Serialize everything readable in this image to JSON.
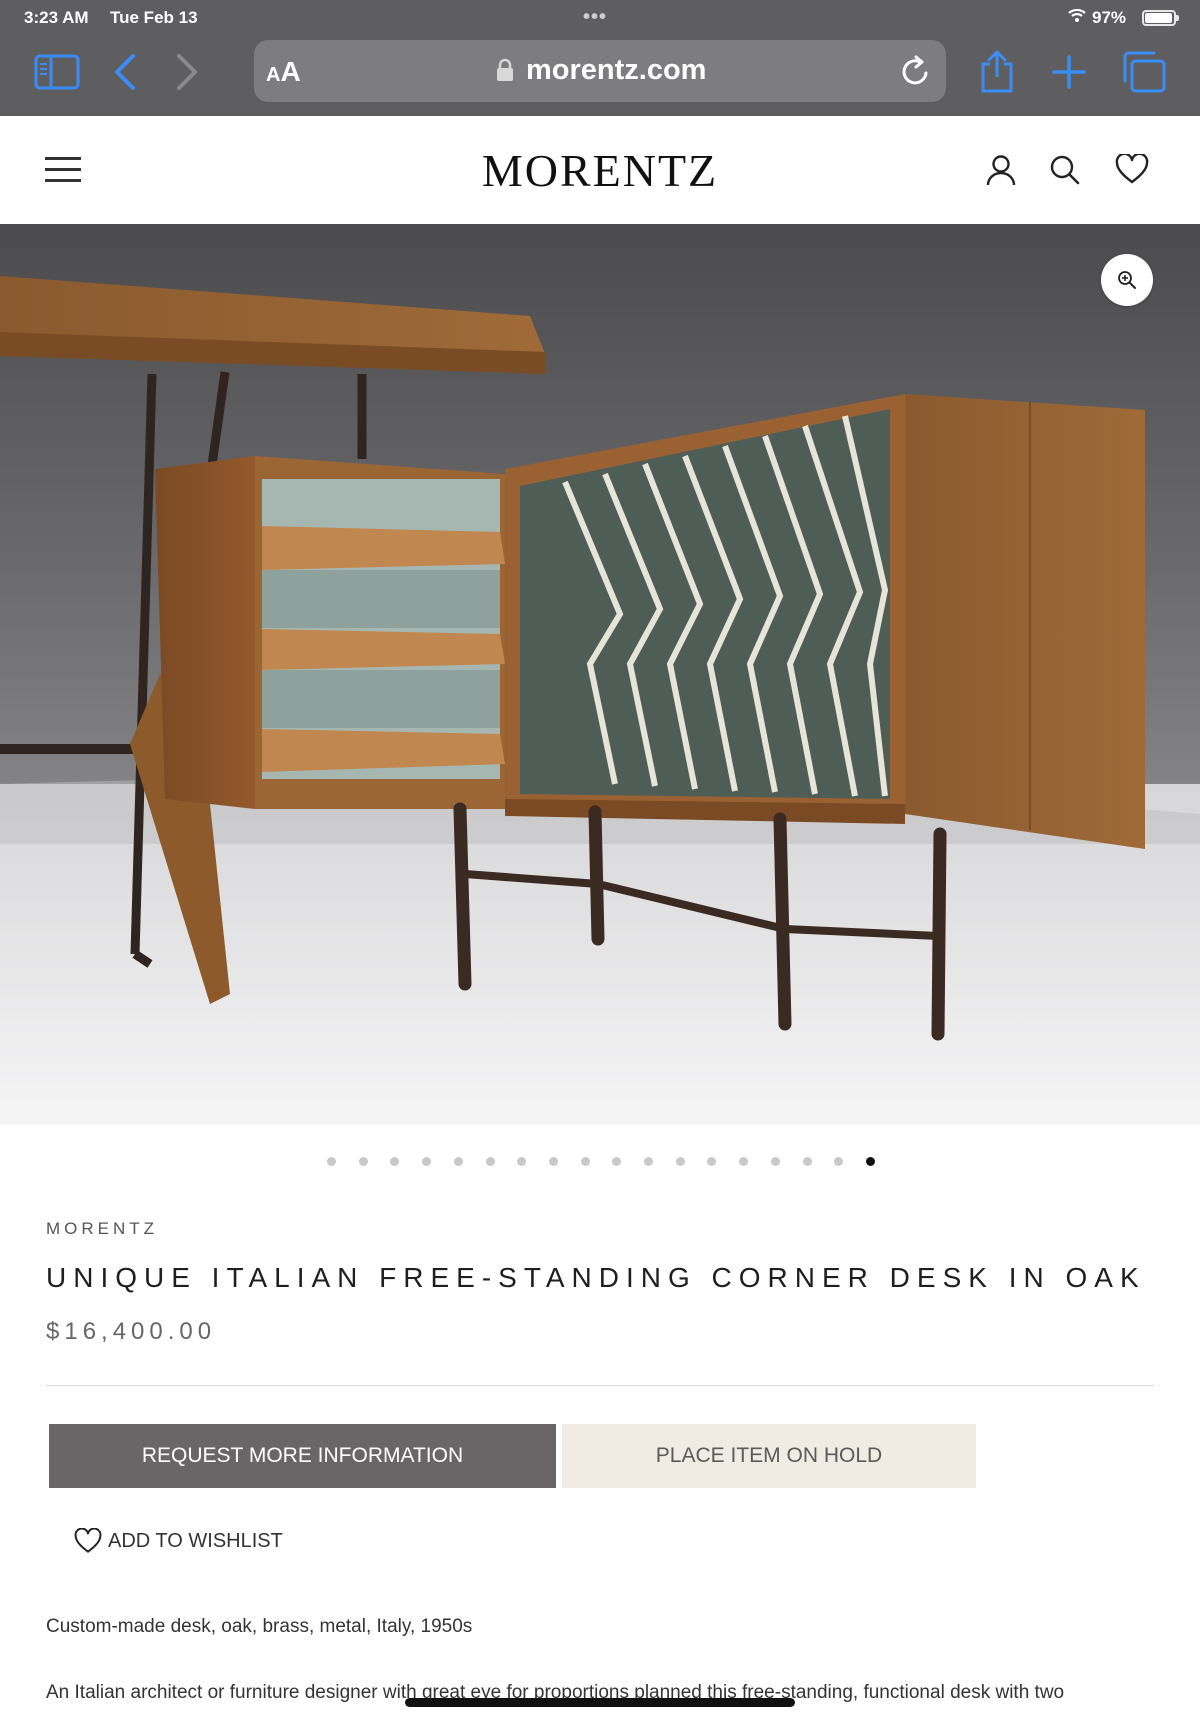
{
  "status_bar": {
    "time": "3:23 AM",
    "date": "Tue Feb 13",
    "battery": "97%",
    "dots": "•••"
  },
  "browser": {
    "text_size_small": "A",
    "text_size_big": "A",
    "url_host": "morentz.com",
    "accent_color": "#3b8cf5"
  },
  "site": {
    "logo": "MORENTZ"
  },
  "gallery": {
    "image_count": 18,
    "active_index": 17
  },
  "product": {
    "vendor": "MORENTZ",
    "title": "UNIQUE ITALIAN FREE-STANDING CORNER DESK IN OAK",
    "price": "$16,400.00",
    "request_label": "REQUEST MORE INFORMATION",
    "hold_label": "PLACE ITEM ON HOLD",
    "wishlist_label": "ADD TO WISHLIST",
    "description_1": "Custom-made desk, oak, brass, metal, Italy, 1950s",
    "description_2": "An Italian architect or furniture designer with great eye for proportions planned this free-standing, functional desk with two"
  },
  "icons": {
    "sidebar": "sidebar-icon",
    "back": "chevron-left-icon",
    "forward": "chevron-right-icon",
    "lock": "lock-icon",
    "reload": "reload-icon",
    "share": "share-icon",
    "new_tab": "plus-icon",
    "tabs": "tabs-icon",
    "menu": "hamburger-menu-icon",
    "account": "user-icon",
    "search": "search-icon",
    "wishlist": "heart-icon",
    "zoom": "zoom-in-icon"
  }
}
